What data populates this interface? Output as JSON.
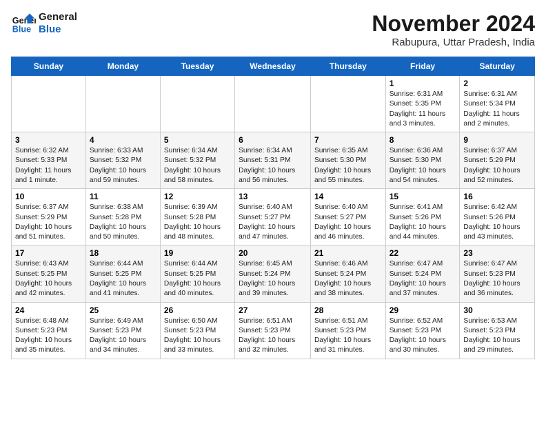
{
  "header": {
    "logo_line1": "General",
    "logo_line2": "Blue",
    "month": "November 2024",
    "location": "Rabupura, Uttar Pradesh, India"
  },
  "weekdays": [
    "Sunday",
    "Monday",
    "Tuesday",
    "Wednesday",
    "Thursday",
    "Friday",
    "Saturday"
  ],
  "weeks": [
    [
      {
        "day": "",
        "info": ""
      },
      {
        "day": "",
        "info": ""
      },
      {
        "day": "",
        "info": ""
      },
      {
        "day": "",
        "info": ""
      },
      {
        "day": "",
        "info": ""
      },
      {
        "day": "1",
        "info": "Sunrise: 6:31 AM\nSunset: 5:35 PM\nDaylight: 11 hours\nand 3 minutes."
      },
      {
        "day": "2",
        "info": "Sunrise: 6:31 AM\nSunset: 5:34 PM\nDaylight: 11 hours\nand 2 minutes."
      }
    ],
    [
      {
        "day": "3",
        "info": "Sunrise: 6:32 AM\nSunset: 5:33 PM\nDaylight: 11 hours\nand 1 minute."
      },
      {
        "day": "4",
        "info": "Sunrise: 6:33 AM\nSunset: 5:32 PM\nDaylight: 10 hours\nand 59 minutes."
      },
      {
        "day": "5",
        "info": "Sunrise: 6:34 AM\nSunset: 5:32 PM\nDaylight: 10 hours\nand 58 minutes."
      },
      {
        "day": "6",
        "info": "Sunrise: 6:34 AM\nSunset: 5:31 PM\nDaylight: 10 hours\nand 56 minutes."
      },
      {
        "day": "7",
        "info": "Sunrise: 6:35 AM\nSunset: 5:30 PM\nDaylight: 10 hours\nand 55 minutes."
      },
      {
        "day": "8",
        "info": "Sunrise: 6:36 AM\nSunset: 5:30 PM\nDaylight: 10 hours\nand 54 minutes."
      },
      {
        "day": "9",
        "info": "Sunrise: 6:37 AM\nSunset: 5:29 PM\nDaylight: 10 hours\nand 52 minutes."
      }
    ],
    [
      {
        "day": "10",
        "info": "Sunrise: 6:37 AM\nSunset: 5:29 PM\nDaylight: 10 hours\nand 51 minutes."
      },
      {
        "day": "11",
        "info": "Sunrise: 6:38 AM\nSunset: 5:28 PM\nDaylight: 10 hours\nand 50 minutes."
      },
      {
        "day": "12",
        "info": "Sunrise: 6:39 AM\nSunset: 5:28 PM\nDaylight: 10 hours\nand 48 minutes."
      },
      {
        "day": "13",
        "info": "Sunrise: 6:40 AM\nSunset: 5:27 PM\nDaylight: 10 hours\nand 47 minutes."
      },
      {
        "day": "14",
        "info": "Sunrise: 6:40 AM\nSunset: 5:27 PM\nDaylight: 10 hours\nand 46 minutes."
      },
      {
        "day": "15",
        "info": "Sunrise: 6:41 AM\nSunset: 5:26 PM\nDaylight: 10 hours\nand 44 minutes."
      },
      {
        "day": "16",
        "info": "Sunrise: 6:42 AM\nSunset: 5:26 PM\nDaylight: 10 hours\nand 43 minutes."
      }
    ],
    [
      {
        "day": "17",
        "info": "Sunrise: 6:43 AM\nSunset: 5:25 PM\nDaylight: 10 hours\nand 42 minutes."
      },
      {
        "day": "18",
        "info": "Sunrise: 6:44 AM\nSunset: 5:25 PM\nDaylight: 10 hours\nand 41 minutes."
      },
      {
        "day": "19",
        "info": "Sunrise: 6:44 AM\nSunset: 5:25 PM\nDaylight: 10 hours\nand 40 minutes."
      },
      {
        "day": "20",
        "info": "Sunrise: 6:45 AM\nSunset: 5:24 PM\nDaylight: 10 hours\nand 39 minutes."
      },
      {
        "day": "21",
        "info": "Sunrise: 6:46 AM\nSunset: 5:24 PM\nDaylight: 10 hours\nand 38 minutes."
      },
      {
        "day": "22",
        "info": "Sunrise: 6:47 AM\nSunset: 5:24 PM\nDaylight: 10 hours\nand 37 minutes."
      },
      {
        "day": "23",
        "info": "Sunrise: 6:47 AM\nSunset: 5:23 PM\nDaylight: 10 hours\nand 36 minutes."
      }
    ],
    [
      {
        "day": "24",
        "info": "Sunrise: 6:48 AM\nSunset: 5:23 PM\nDaylight: 10 hours\nand 35 minutes."
      },
      {
        "day": "25",
        "info": "Sunrise: 6:49 AM\nSunset: 5:23 PM\nDaylight: 10 hours\nand 34 minutes."
      },
      {
        "day": "26",
        "info": "Sunrise: 6:50 AM\nSunset: 5:23 PM\nDaylight: 10 hours\nand 33 minutes."
      },
      {
        "day": "27",
        "info": "Sunrise: 6:51 AM\nSunset: 5:23 PM\nDaylight: 10 hours\nand 32 minutes."
      },
      {
        "day": "28",
        "info": "Sunrise: 6:51 AM\nSunset: 5:23 PM\nDaylight: 10 hours\nand 31 minutes."
      },
      {
        "day": "29",
        "info": "Sunrise: 6:52 AM\nSunset: 5:23 PM\nDaylight: 10 hours\nand 30 minutes."
      },
      {
        "day": "30",
        "info": "Sunrise: 6:53 AM\nSunset: 5:23 PM\nDaylight: 10 hours\nand 29 minutes."
      }
    ]
  ]
}
